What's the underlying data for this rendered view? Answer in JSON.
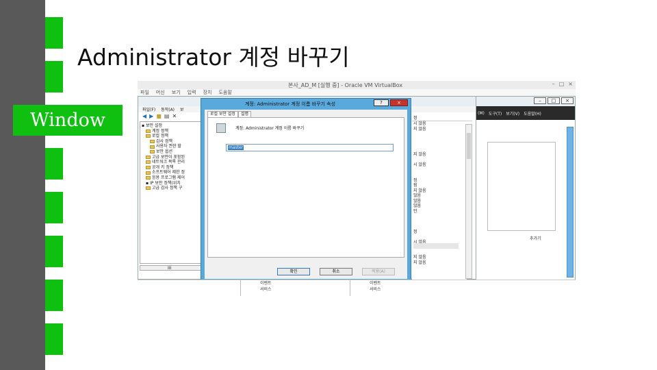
{
  "slide": {
    "title": "Administrator 계정 바꾸기",
    "section_tag": "Window",
    "colors": {
      "accent": "#10c010",
      "left_bar": "#595959"
    }
  },
  "virtualbox": {
    "title": "본사_AD_M [실행 중] - Oracle VM VirtualBox",
    "menu": [
      "파일",
      "머신",
      "보기",
      "입력",
      "장치",
      "도움말"
    ],
    "window_controls": [
      "–",
      "□",
      "×"
    ]
  },
  "mmc_right": {
    "menu": [
      "(M)",
      "도구(T)",
      "보기(V)",
      "도움말(H)"
    ],
    "more_label": "추가기"
  },
  "mmc_left": {
    "menu": [
      "파일(F)",
      "동작(A)",
      "보"
    ],
    "tree": [
      "보안 설정",
      "계정 정책",
      "로컬 정책",
      "감사 정책",
      "사용자 권한 할",
      "보안 옵션",
      "고급 보안이 포함된",
      "네트워크 목록 관리",
      "공개 키 정책",
      "소프트웨어 제한 정",
      "응용 프로그램 제어",
      "IP 보안 정책(위치",
      "고급 감사 정책 구"
    ],
    "hscroll_label": "III",
    "list_header": "정",
    "list": [
      "시 않음",
      "지 않음",
      "",
      "",
      "",
      "",
      "지 않음",
      "",
      "시 않음",
      "",
      "",
      "정",
      "됨",
      "지 않음",
      "않음",
      "않음",
      "않음",
      "안",
      "",
      "",
      "",
      "정",
      "",
      "시 않음",
      "",
      "",
      "지 않음",
      "지 않음"
    ]
  },
  "dialog": {
    "title": "계정: Administrator 계정 이름 바꾸기 속성",
    "help_label": "?",
    "close_label": "×",
    "tabs": [
      "로컬 보안 설정",
      "설명"
    ],
    "policy_label": "계정: Administrator 계정 이름 바꾸기",
    "value": "master",
    "buttons": {
      "ok": "확인",
      "cancel": "취소",
      "apply": "적용(A)"
    }
  },
  "bottom": {
    "col1": [
      "이벤트",
      "서비스"
    ],
    "col2": [
      "이벤트",
      "서비스"
    ]
  }
}
